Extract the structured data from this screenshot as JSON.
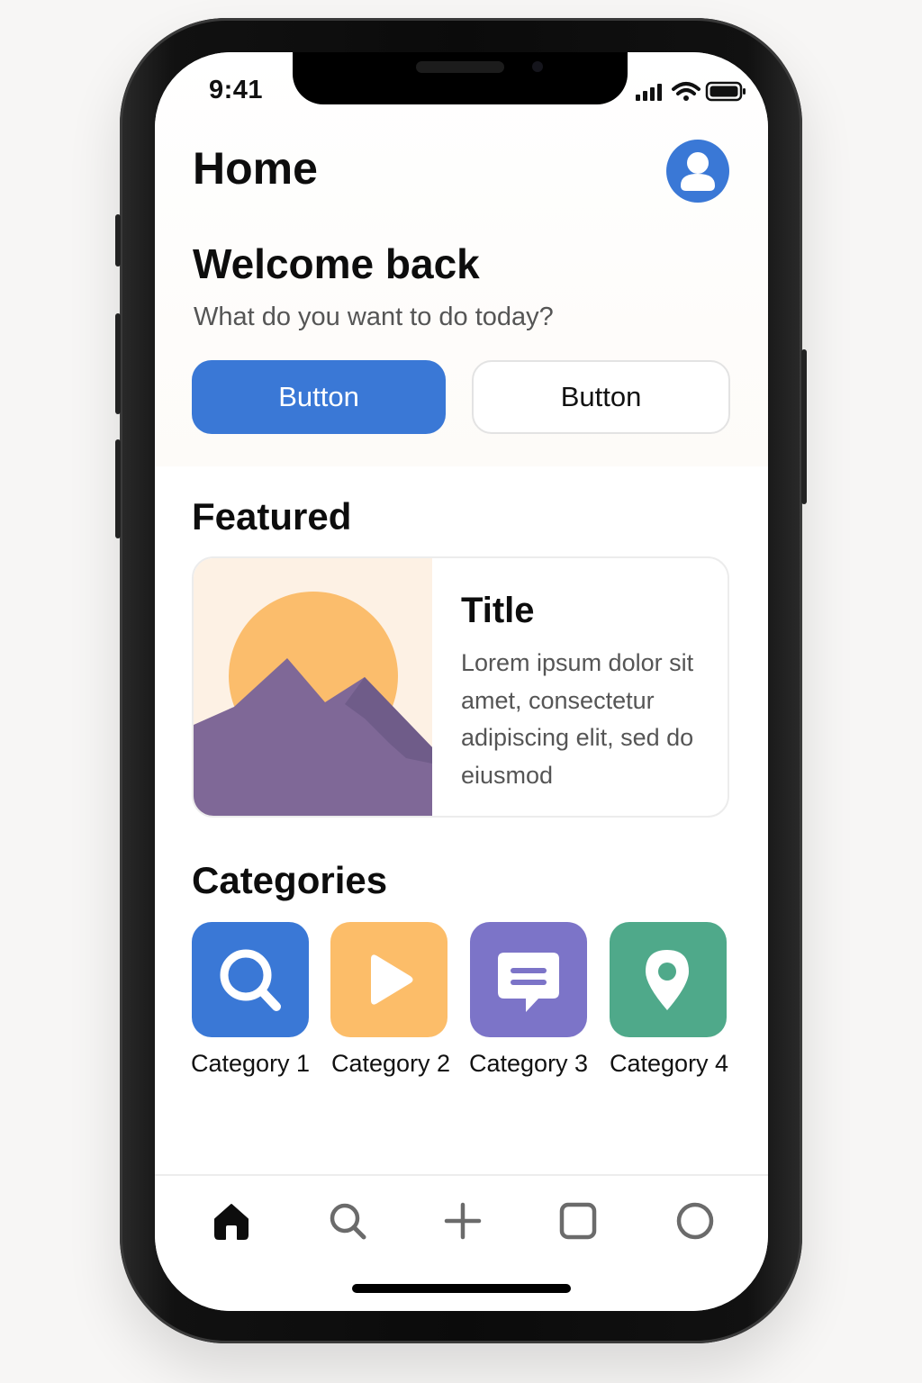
{
  "status_bar": {
    "time": "9:41",
    "icons": [
      "signal-icon",
      "wifi-icon",
      "battery-icon"
    ]
  },
  "header": {
    "title": "Home",
    "avatar_icon": "user-icon"
  },
  "hero": {
    "title": "Welcome back",
    "subtitle": "What do you want to do today?",
    "primary_button": "Button",
    "secondary_button": "Button"
  },
  "featured": {
    "heading": "Featured",
    "card": {
      "image_icon": "mountain-sun-image",
      "title": "Title",
      "body": "Lorem ipsum dolor sit amet, consectetur adipiscing elit, sed do eiusmod"
    }
  },
  "categories": {
    "heading": "Categories",
    "items": [
      {
        "label": "Category 1",
        "icon": "search-icon",
        "color": "#3a78d6"
      },
      {
        "label": "Category 2",
        "icon": "play-icon",
        "color": "#fcbd69"
      },
      {
        "label": "Category 3",
        "icon": "chat-icon",
        "color": "#7c74c8"
      },
      {
        "label": "Category 4",
        "icon": "location-pin-icon",
        "color": "#4fa98a"
      }
    ]
  },
  "tab_bar": {
    "tabs": [
      {
        "icon": "home-icon",
        "active": true
      },
      {
        "icon": "search-icon",
        "active": false
      },
      {
        "icon": "plus-icon",
        "active": false
      },
      {
        "icon": "square-icon",
        "active": false
      },
      {
        "icon": "circle-icon",
        "active": false
      }
    ]
  },
  "colors": {
    "accent": "#3a78d6",
    "text_primary": "#0d0d0d",
    "text_secondary": "#555555"
  }
}
